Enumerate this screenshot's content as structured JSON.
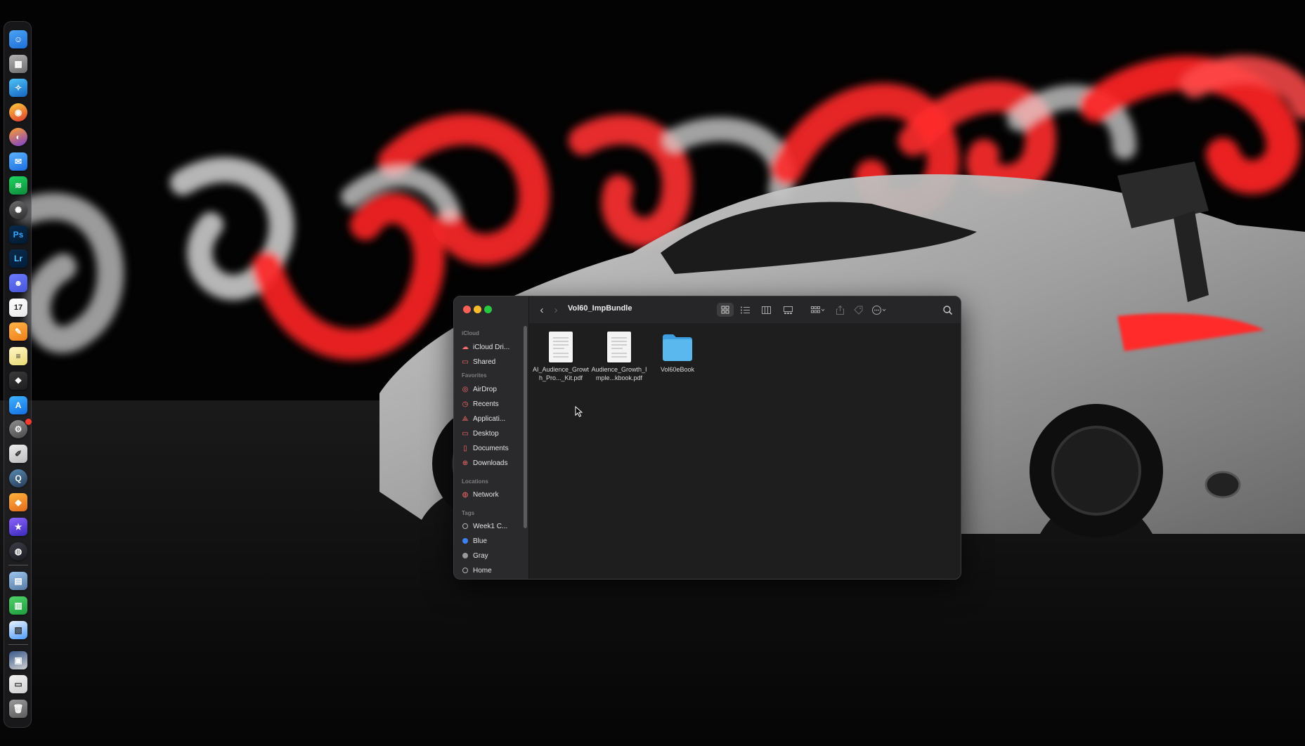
{
  "colors": {
    "accent_red": "#ff2b2b",
    "window_bg": "#1e1e1e",
    "sidebar_bg": "#2a2a2c",
    "folder_blue": "#5ab8ef"
  },
  "dock": {
    "apps": [
      {
        "name": "finder-icon",
        "glyph": "☺"
      },
      {
        "name": "launchpad-icon",
        "glyph": "▦"
      },
      {
        "name": "safari-icon",
        "glyph": "✧"
      },
      {
        "name": "chrome-icon",
        "glyph": "◉"
      },
      {
        "name": "firefox-icon",
        "glyph": "◐"
      },
      {
        "name": "mail-icon",
        "glyph": "✉"
      },
      {
        "name": "spotify-icon",
        "glyph": "≋"
      },
      {
        "name": "chatgpt-icon",
        "glyph": "✺"
      },
      {
        "name": "photoshop-icon",
        "glyph": "Ps"
      },
      {
        "name": "lightroom-icon",
        "glyph": "Lr"
      },
      {
        "name": "discord-icon",
        "glyph": "☻"
      },
      {
        "name": "calendar-icon",
        "glyph": "17"
      },
      {
        "name": "pages-icon",
        "glyph": "✎"
      },
      {
        "name": "notes-icon",
        "glyph": "≡"
      },
      {
        "name": "perplexity-icon",
        "glyph": "❖"
      },
      {
        "name": "app-store-icon",
        "glyph": "A"
      },
      {
        "name": "system-settings-icon",
        "glyph": "⚙"
      },
      {
        "name": "script-editor-icon",
        "glyph": "✐"
      },
      {
        "name": "quicktime-icon",
        "glyph": "Q"
      },
      {
        "name": "box-app-icon",
        "glyph": "◆"
      },
      {
        "name": "imovie-icon",
        "glyph": "★"
      },
      {
        "name": "obs-icon",
        "glyph": "◍"
      }
    ],
    "recents": [
      {
        "name": "preview-icon",
        "glyph": "▤"
      },
      {
        "name": "numbers-icon",
        "glyph": "▥"
      },
      {
        "name": "keynote-icon",
        "glyph": "▧"
      }
    ],
    "others": [
      {
        "name": "downloads-stack-icon",
        "glyph": "▣"
      },
      {
        "name": "document-stack-icon",
        "glyph": "▭"
      },
      {
        "name": "trash-icon",
        "glyph": "🗑"
      }
    ]
  },
  "finder": {
    "title": "Vol60_ImpBundle",
    "sidebar": {
      "icloud_header": "iCloud",
      "icloud": [
        {
          "label": "iCloud Dri...",
          "icon": "☁"
        },
        {
          "label": "Shared",
          "icon": "▭"
        }
      ],
      "favorites_header": "Favorites",
      "favorites": [
        {
          "label": "AirDrop",
          "icon": "◎"
        },
        {
          "label": "Recents",
          "icon": "◷"
        },
        {
          "label": "Applicati...",
          "icon": "⟁"
        },
        {
          "label": "Desktop",
          "icon": "▭"
        },
        {
          "label": "Documents",
          "icon": "▯"
        },
        {
          "label": "Downloads",
          "icon": "⊕"
        }
      ],
      "locations_header": "Locations",
      "locations": [
        {
          "label": "Network",
          "icon": "◍"
        }
      ],
      "tags_header": "Tags",
      "tags": [
        {
          "label": "Week1 C...",
          "color": "#2a2a2c",
          "outline": true
        },
        {
          "label": "Blue",
          "color": "#3b82f6",
          "outline": false
        },
        {
          "label": "Gray",
          "color": "#9a9a9a",
          "outline": false
        },
        {
          "label": "Home",
          "color": "#2a2a2c",
          "outline": true
        }
      ]
    },
    "files": [
      {
        "name": "AI_Audience_Growth_Pro..._Kit.pdf",
        "kind": "pdf"
      },
      {
        "name": "Audience_Growth_Imple...kbook.pdf",
        "kind": "pdf"
      },
      {
        "name": "Vol60eBook",
        "kind": "folder"
      }
    ]
  }
}
